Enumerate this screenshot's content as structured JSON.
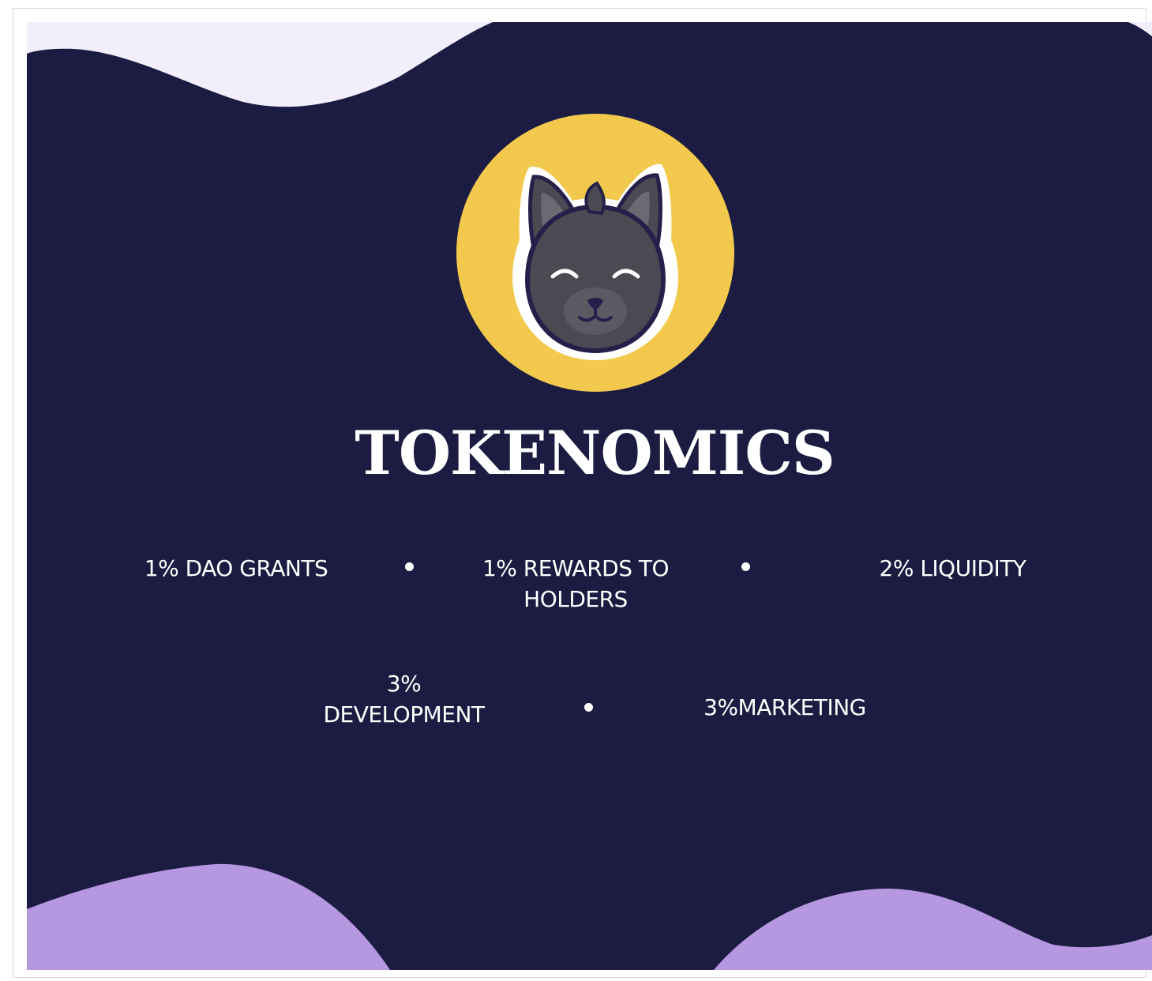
{
  "slide": {
    "title": "TOKENOMICS",
    "colors": {
      "background": "#1c1c42",
      "top_wave": "#f3eefb",
      "bottom_wave": "#b698e0",
      "logo_circle": "#f2c94c",
      "text": "#ffffff"
    },
    "logo": {
      "icon": "cat-head-icon"
    },
    "allocations": [
      {
        "text": "1% DAO GRANTS"
      },
      {
        "text": "1% REWARDS TO HOLDERS"
      },
      {
        "text": "2% LIQUIDITY"
      },
      {
        "text": "3% DEVELOPMENT"
      },
      {
        "text": "3%MARKETING"
      }
    ]
  }
}
